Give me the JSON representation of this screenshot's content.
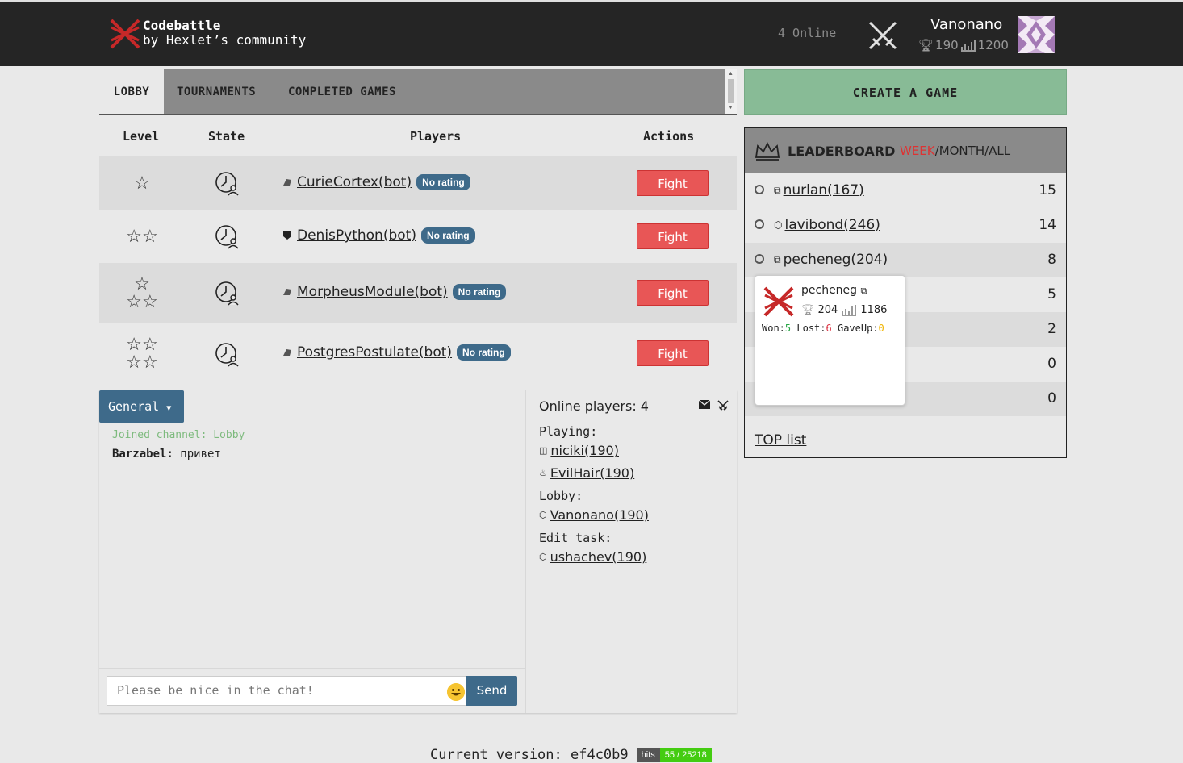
{
  "header": {
    "brand_line1": "Codebattle",
    "brand_line2": "by Hexlet’s community",
    "online_text": "4 Online",
    "user_name": "Vanonano",
    "user_rating": "190",
    "user_elo": "1200"
  },
  "tabs": [
    {
      "label": "LOBBY",
      "active": true
    },
    {
      "label": "TOURNAMENTS",
      "active": false
    },
    {
      "label": "COMPLETED GAMES",
      "active": false
    }
  ],
  "table": {
    "headers": {
      "level": "Level",
      "state": "State",
      "players": "Players",
      "actions": "Actions"
    },
    "rows": [
      {
        "level_stars": 1,
        "player": "CurieCortex(bot)",
        "badge": "No rating",
        "lang_icon": "js-icon",
        "action": "Fight"
      },
      {
        "level_stars": 2,
        "player": "DenisPython(bot)",
        "badge": "No rating",
        "lang_icon": "php-icon",
        "action": "Fight"
      },
      {
        "level_stars": 3,
        "player": "MorpheusModule(bot)",
        "badge": "No rating",
        "lang_icon": "js-icon",
        "action": "Fight"
      },
      {
        "level_stars": 4,
        "player": "PostgresPostulate(bot)",
        "badge": "No rating",
        "lang_icon": "js-icon",
        "action": "Fight"
      }
    ]
  },
  "create_game": "CREATE A GAME",
  "leaderboard": {
    "title": "LEADERBOARD",
    "filter_week": "WEEK",
    "filter_month": "MONTH",
    "filter_all": "ALL",
    "sep": "/",
    "rows": [
      {
        "name": "nurlan(167)",
        "score": "15",
        "lang_icon": "python-icon"
      },
      {
        "name": "lavibond(246)",
        "score": "14",
        "lang_icon": "ruby-icon"
      },
      {
        "name": "pecheneg(204)",
        "score": "8",
        "lang_icon": "python-icon"
      },
      {
        "name": "",
        "score": "5",
        "lang_icon": ""
      },
      {
        "name": "",
        "score": "2",
        "lang_icon": ""
      },
      {
        "name": "",
        "score": "0",
        "lang_icon": ""
      },
      {
        "name": "0)",
        "score": "0",
        "lang_icon": ""
      }
    ],
    "top_list": "TOP list"
  },
  "popover": {
    "name": "pecheneg",
    "rating": "204",
    "elo": "1186",
    "won_label": "Won:",
    "won": "5",
    "lost_label": "Lost:",
    "lost": "6",
    "gaveup_label": "GaveUp:",
    "gaveup": "0"
  },
  "chat": {
    "channel": "General",
    "joined": "Joined channel: Lobby",
    "messages": [
      {
        "author": "Barzabel:",
        "text": "привет"
      }
    ],
    "placeholder": "Please be nice in the chat!",
    "send": "Send"
  },
  "online_panel": {
    "title": "Online players: 4",
    "playing_label": "Playing:",
    "playing": [
      "niciki(190)",
      "EvilHair(190)"
    ],
    "lobby_label": "Lobby:",
    "lobby": [
      "Vanonano(190)"
    ],
    "edit_label": "Edit task:",
    "edit": [
      "ushachev(190)"
    ]
  },
  "footer": {
    "version_label": "Current version: ef4c0b9",
    "hits_label": "hits",
    "hits_value": "55 / 25218"
  },
  "colors": {
    "accent": "#3e6a8a",
    "fight": "#e85656",
    "create": "#88bb96",
    "header": "#252525"
  }
}
